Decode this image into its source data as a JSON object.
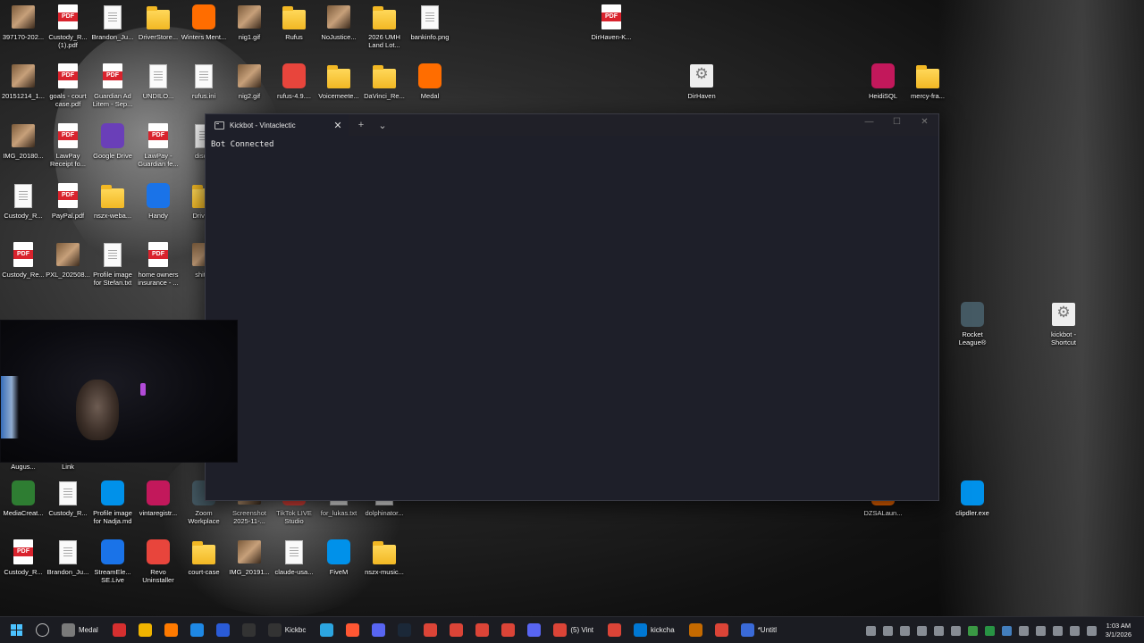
{
  "desktop": {
    "icons": [
      {
        "label": "397170-202...",
        "kind": "img"
      },
      {
        "label": "Custody_R... (1).pdf",
        "kind": "pdf"
      },
      {
        "label": "Brandon_Ju...",
        "kind": "doc"
      },
      {
        "label": "DriverStore...",
        "kind": "folder"
      },
      {
        "label": "Winters Ment...",
        "kind": "app"
      },
      {
        "label": "nig1.gif",
        "kind": "img"
      },
      {
        "label": "Rufus",
        "kind": "folder"
      },
      {
        "label": "NoJustice...",
        "kind": "img"
      },
      {
        "label": "2026 UMH Land Lot...",
        "kind": "folder"
      },
      {
        "label": "bankinfo.png",
        "kind": "doc"
      },
      {
        "label": "DirHaven-K...",
        "kind": "pdf"
      },
      {
        "label": "20151214_1...",
        "kind": "img"
      },
      {
        "label": "goals - court case.pdf",
        "kind": "pdf"
      },
      {
        "label": "Guardian Ad Litem - Sep...",
        "kind": "pdf"
      },
      {
        "label": "UNDILO...",
        "kind": "doc"
      },
      {
        "label": "rufus.ini",
        "kind": "doc"
      },
      {
        "label": "nig2.gif",
        "kind": "img"
      },
      {
        "label": "rufus-4.9....",
        "kind": "app"
      },
      {
        "label": "Voicemeete...",
        "kind": "folder"
      },
      {
        "label": "DaVinci_Re...",
        "kind": "folder"
      },
      {
        "label": "Medal",
        "kind": "app"
      },
      {
        "label": "DirHaven",
        "kind": "gear"
      },
      {
        "label": "HeidiSQL",
        "kind": "app"
      },
      {
        "label": "mercy-fra...",
        "kind": "folder"
      },
      {
        "label": "IMG_20180...",
        "kind": "img"
      },
      {
        "label": "LawPay Receipt fo...",
        "kind": "pdf"
      },
      {
        "label": "Google Drive",
        "kind": "app"
      },
      {
        "label": "LawPay - Guardian fe...",
        "kind": "pdf"
      },
      {
        "label": "discor",
        "kind": "doc"
      },
      {
        "label": "Custody_R...",
        "kind": "doc"
      },
      {
        "label": "PayPal.pdf",
        "kind": "pdf"
      },
      {
        "label": "nszx-weba...",
        "kind": "folder"
      },
      {
        "label": "Handy",
        "kind": "app"
      },
      {
        "label": "DriverS",
        "kind": "folder"
      },
      {
        "label": "Custody_Re...",
        "kind": "pdf"
      },
      {
        "label": "PXL_202508...",
        "kind": "img"
      },
      {
        "label": "Profile image for Stefan.txt",
        "kind": "doc"
      },
      {
        "label": "home owners insurance - ...",
        "kind": "pdf"
      },
      {
        "label": "shitco",
        "kind": "img"
      },
      {
        "label": "Rocket League®",
        "kind": "app"
      },
      {
        "label": "kickbot - Shortcut",
        "kind": "gear"
      },
      {
        "label": "Augus...",
        "kind": "img"
      },
      {
        "label": "Link",
        "kind": "img"
      },
      {
        "label": "MediaCreat...",
        "kind": "app"
      },
      {
        "label": "Custody_R...",
        "kind": "doc"
      },
      {
        "label": "Profile image for Nadja.md",
        "kind": "app"
      },
      {
        "label": "vintaregistr...",
        "kind": "app"
      },
      {
        "label": "Zoom Workplace",
        "kind": "app"
      },
      {
        "label": "Screenshot 2025-11-...",
        "kind": "img"
      },
      {
        "label": "TikTok LIVE Studio",
        "kind": "app"
      },
      {
        "label": "for_lukas.txt",
        "kind": "doc"
      },
      {
        "label": "dolphinator...",
        "kind": "doc"
      },
      {
        "label": "DZSALaun...",
        "kind": "app"
      },
      {
        "label": "clipdler.exe",
        "kind": "app"
      },
      {
        "label": "Custody_R...",
        "kind": "pdf"
      },
      {
        "label": "Brandon_Ju...",
        "kind": "doc"
      },
      {
        "label": "StreamEle... SE.Live",
        "kind": "app"
      },
      {
        "label": "Revo Uninstaller",
        "kind": "app"
      },
      {
        "label": "court-case",
        "kind": "folder"
      },
      {
        "label": "IMG_20191...",
        "kind": "img"
      },
      {
        "label": "claude-usa...",
        "kind": "doc"
      },
      {
        "label": "FiveM",
        "kind": "app"
      },
      {
        "label": "nszx-music...",
        "kind": "folder"
      }
    ]
  },
  "terminal": {
    "tab_title": "Kickbot - Vintaclectic",
    "tab_close": "✕",
    "new_tab": "+",
    "dropdown": "⌄",
    "minimize": "—",
    "maximize": "☐",
    "close": "✕",
    "output": "Bot Connected"
  },
  "taskbar": {
    "start_icon": "windows-icon",
    "items": [
      {
        "name": "search",
        "label": ""
      },
      {
        "name": "medal",
        "label": "Medal"
      },
      {
        "name": "acrobat",
        "label": ""
      },
      {
        "name": "explorer",
        "label": ""
      },
      {
        "name": "firefox",
        "label": ""
      },
      {
        "name": "app1",
        "label": ""
      },
      {
        "name": "powershell",
        "label": ""
      },
      {
        "name": "terminal1",
        "label": ""
      },
      {
        "name": "kickbot-terminal",
        "label": "Kickbc"
      },
      {
        "name": "telegram",
        "label": ""
      },
      {
        "name": "app2",
        "label": ""
      },
      {
        "name": "app3",
        "label": ""
      },
      {
        "name": "steam",
        "label": ""
      },
      {
        "name": "chrome1",
        "label": ""
      },
      {
        "name": "chrome2",
        "label": ""
      },
      {
        "name": "chrome3",
        "label": ""
      },
      {
        "name": "chrome4",
        "label": ""
      },
      {
        "name": "discord",
        "label": ""
      },
      {
        "name": "chrome-vint",
        "label": "(5) Vint"
      },
      {
        "name": "chrome5",
        "label": ""
      },
      {
        "name": "vscode",
        "label": "kickcha"
      },
      {
        "name": "app4",
        "label": ""
      },
      {
        "name": "chrome6",
        "label": ""
      },
      {
        "name": "notepad",
        "label": "*Untitl"
      }
    ],
    "clock_time": "1:03 AM",
    "clock_date": "3/1/2026"
  },
  "colors": {
    "terminal_bg": "#1e1f29",
    "taskbar_bg": "#1b1c22",
    "pdf_red": "#d9232d"
  }
}
